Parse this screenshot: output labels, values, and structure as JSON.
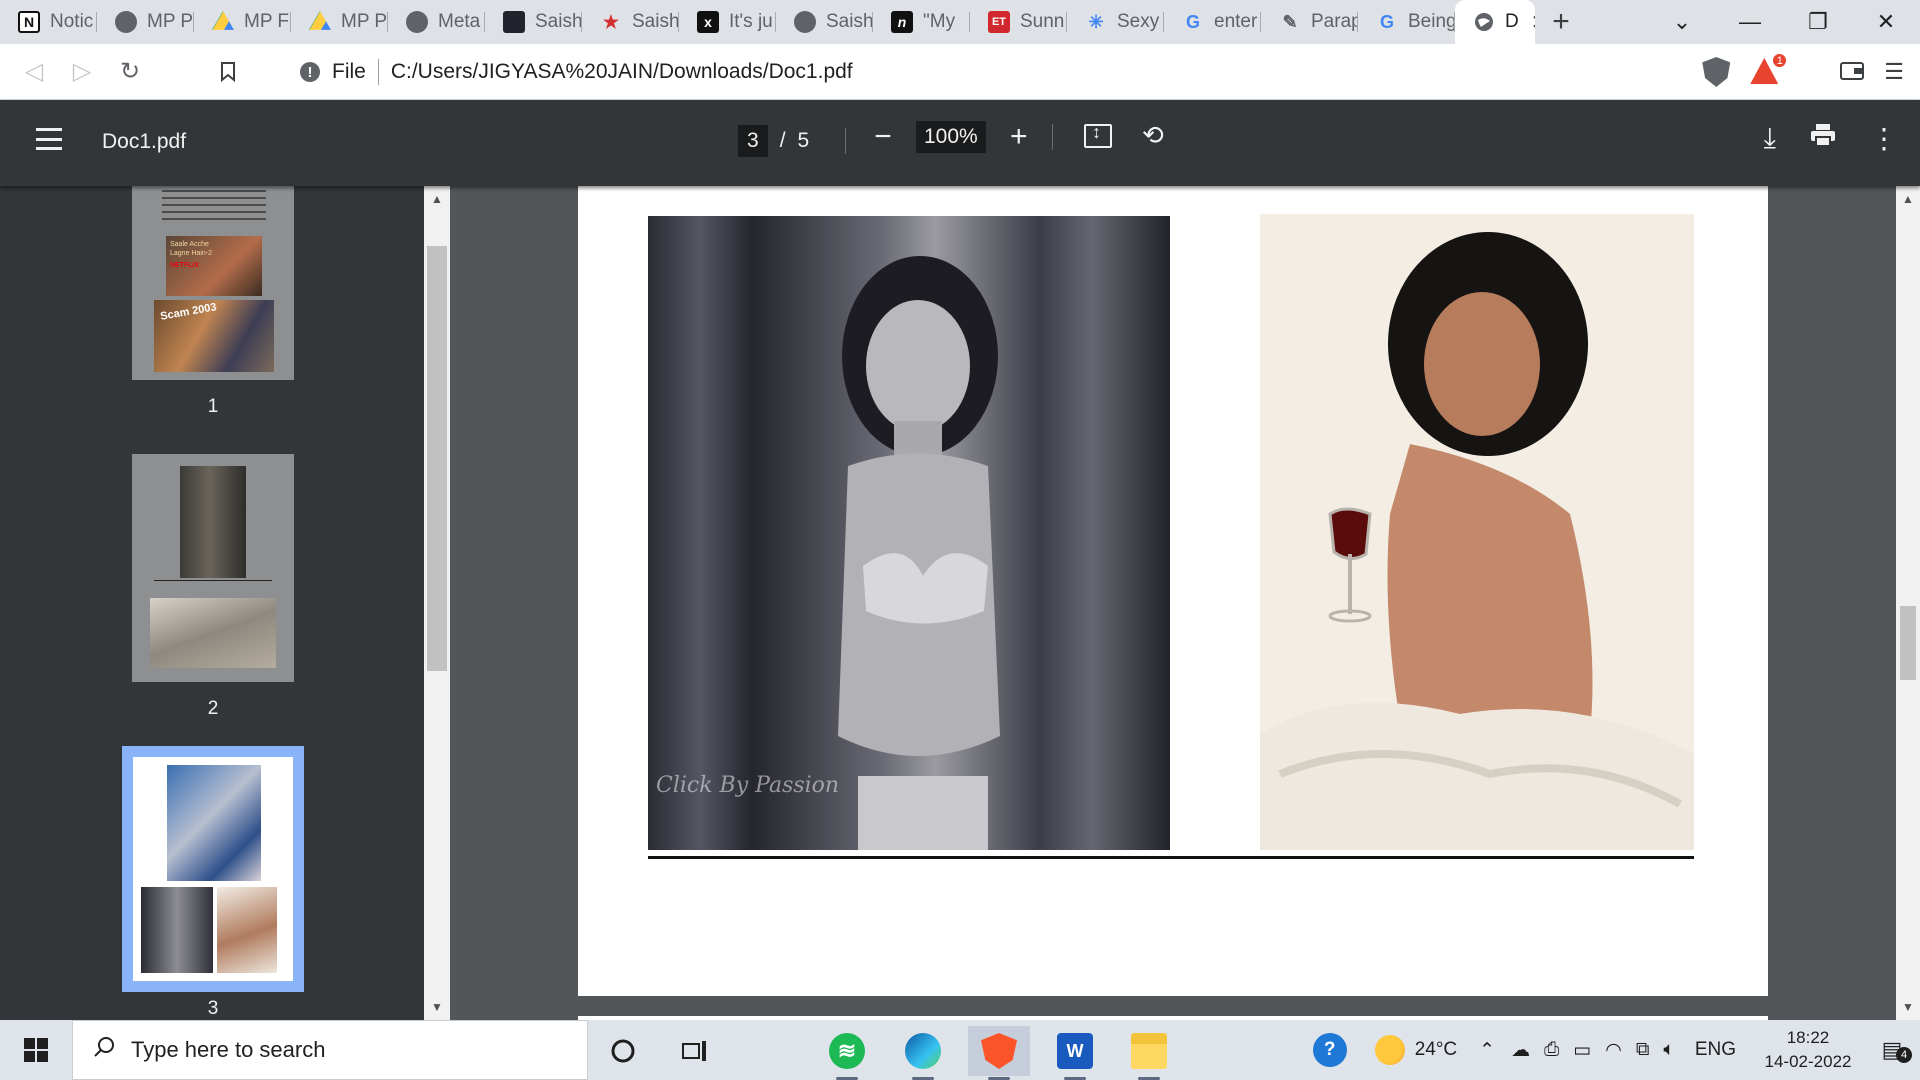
{
  "browser": {
    "tabs": [
      {
        "label": "Notic",
        "icon": "notion-icon"
      },
      {
        "label": "MP P",
        "icon": "globe-icon"
      },
      {
        "label": "MP F",
        "icon": "google-drive-icon"
      },
      {
        "label": "MP P",
        "icon": "google-drive-icon"
      },
      {
        "label": "Meta",
        "icon": "globe-icon"
      },
      {
        "label": "Saish",
        "icon": "news-icon"
      },
      {
        "label": "Saish",
        "icon": "star-icon"
      },
      {
        "label": "It's ju",
        "icon": "x-icon"
      },
      {
        "label": "Saish",
        "icon": "globe-icon"
      },
      {
        "label": "\"My",
        "icon": "n18-icon"
      },
      {
        "label": "Sunn",
        "icon": "et-icon"
      },
      {
        "label": "Sexy",
        "icon": "pinwheel-icon"
      },
      {
        "label": "enter",
        "icon": "google-icon"
      },
      {
        "label": "Parap",
        "icon": "quill-icon"
      },
      {
        "label": "Being",
        "icon": "google-icon"
      }
    ],
    "active_tab": {
      "label": "D",
      "icon": "globe-icon"
    },
    "address": {
      "scheme": "File",
      "url": "C:/Users/JIGYASA%20JAIN/Downloads/Doc1.pdf"
    },
    "rewards_badge": "1",
    "colors": {
      "accent": "#8ab4f8",
      "toolbar": "#323639",
      "viewer_bg": "#525659"
    }
  },
  "pdf": {
    "title": "Doc1.pdf",
    "current_page": "3",
    "page_separator": "/",
    "total_pages": "5",
    "zoom": "100%",
    "thumbnails": [
      {
        "number": "1"
      },
      {
        "number": "2"
      },
      {
        "number": "3"
      }
    ],
    "thumbnail_texts": {
      "p1_brand": "NETFLIX",
      "p1_show": "Scam 2003",
      "p1_caption": "Saale Acche Lagne Hain-2"
    },
    "page": {
      "watermark": "Click By Passion"
    }
  },
  "taskbar": {
    "search_placeholder": "Type here to search",
    "weather": "24°C",
    "language": "ENG",
    "time": "18:22",
    "date": "14-02-2022",
    "notification_count": "4"
  }
}
